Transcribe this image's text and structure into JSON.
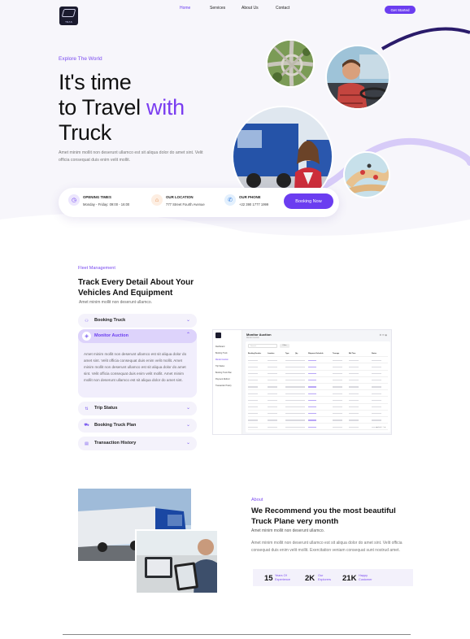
{
  "nav": {
    "logo_text": "TRAS",
    "links": [
      "Home",
      "Services",
      "About Us",
      "Contact"
    ],
    "cta": "Get Started"
  },
  "hero": {
    "eyebrow": "Explore The World",
    "title_line1": "It's time",
    "title_line2_a": "to Travel ",
    "title_line2_b": "with",
    "title_line3": "Truck",
    "description": "Amet minim mollit non deserunt ullamco est sit aliqua dolor do amet sint. Velit officia consequat duis enim velit mollit.",
    "accent_color": "#6b3df0"
  },
  "info_bar": {
    "items": [
      {
        "title": "OPENING TIMES",
        "value": "Monday - Friday: 09:00 - 16:00",
        "icon": "clock-icon"
      },
      {
        "title": "OUR LOCATION",
        "value": "777 Street Fourth Avenue",
        "icon": "location-icon"
      },
      {
        "title": "OUR PHONE",
        "value": "+22 390 1777 1999",
        "icon": "phone-icon"
      }
    ],
    "button": "Booking Now"
  },
  "fleet": {
    "eyebrow": "Fleet Management",
    "title": "Track Every Detail About Your Vehicles And Equipment",
    "subtitle": "Amet minim mollit non deserunt ullamco.",
    "accordion": [
      {
        "label": "Booking Truck",
        "icon": "user-icon"
      },
      {
        "label": "Monitor Auction",
        "icon": "compass-icon",
        "open": true,
        "body": "Amet minim mollit non deserunt ullamco est sit aliqua dolor do amet sint. Velit officia consequat duis enim velit mollit. Amet minim mollit non deserunt ullamco est sit aliqua dolor do amet sint. Velit officia consequat duis enim velit mollit. Amet minim mollit non deserunt ullamco est sit aliqua dolor do amet sint."
      },
      {
        "label": "Trip Status",
        "icon": "route-icon"
      },
      {
        "label": "Booking Truck Plan",
        "icon": "truck-icon"
      },
      {
        "label": "Transaction History",
        "icon": "receipt-icon"
      }
    ]
  },
  "dashboard": {
    "title": "Monitor Auction",
    "crumb": "Monitor Auction",
    "search_placeholder": "Search",
    "filter_button": "Filter",
    "nav": [
      "Dashboard",
      "Booking Truck",
      "Monitor Auction",
      "Trip Status",
      "Booking Truck Plan",
      "Payment Method",
      "Transaction History"
    ],
    "columns": [
      "Booking Number",
      "Location",
      "Type",
      "Qty",
      "Shipment Schedule",
      "Tonnage",
      "Bid Time",
      "Status"
    ],
    "row_count": 11
  },
  "about": {
    "eyebrow": "About",
    "title": "We Recommend you the most beautiful Truck Plane very month",
    "subtitle": "Amet minim mollit non deserunt ullamco.",
    "description": "Amet minim mollit non deserunt ullamco est sit aliqua dolor do amet sint. Velit officia consequat duis enim velit mollit. Exercitation veniam consequat sunt nostrud amet.",
    "stats": [
      {
        "number": "15",
        "label_1": "Years Of",
        "label_2": "Experience"
      },
      {
        "number": "2K",
        "label_1": "Our",
        "label_2": "Explorers"
      },
      {
        "number": "21K",
        "label_1": "Happy",
        "label_2": "Customer"
      }
    ]
  }
}
